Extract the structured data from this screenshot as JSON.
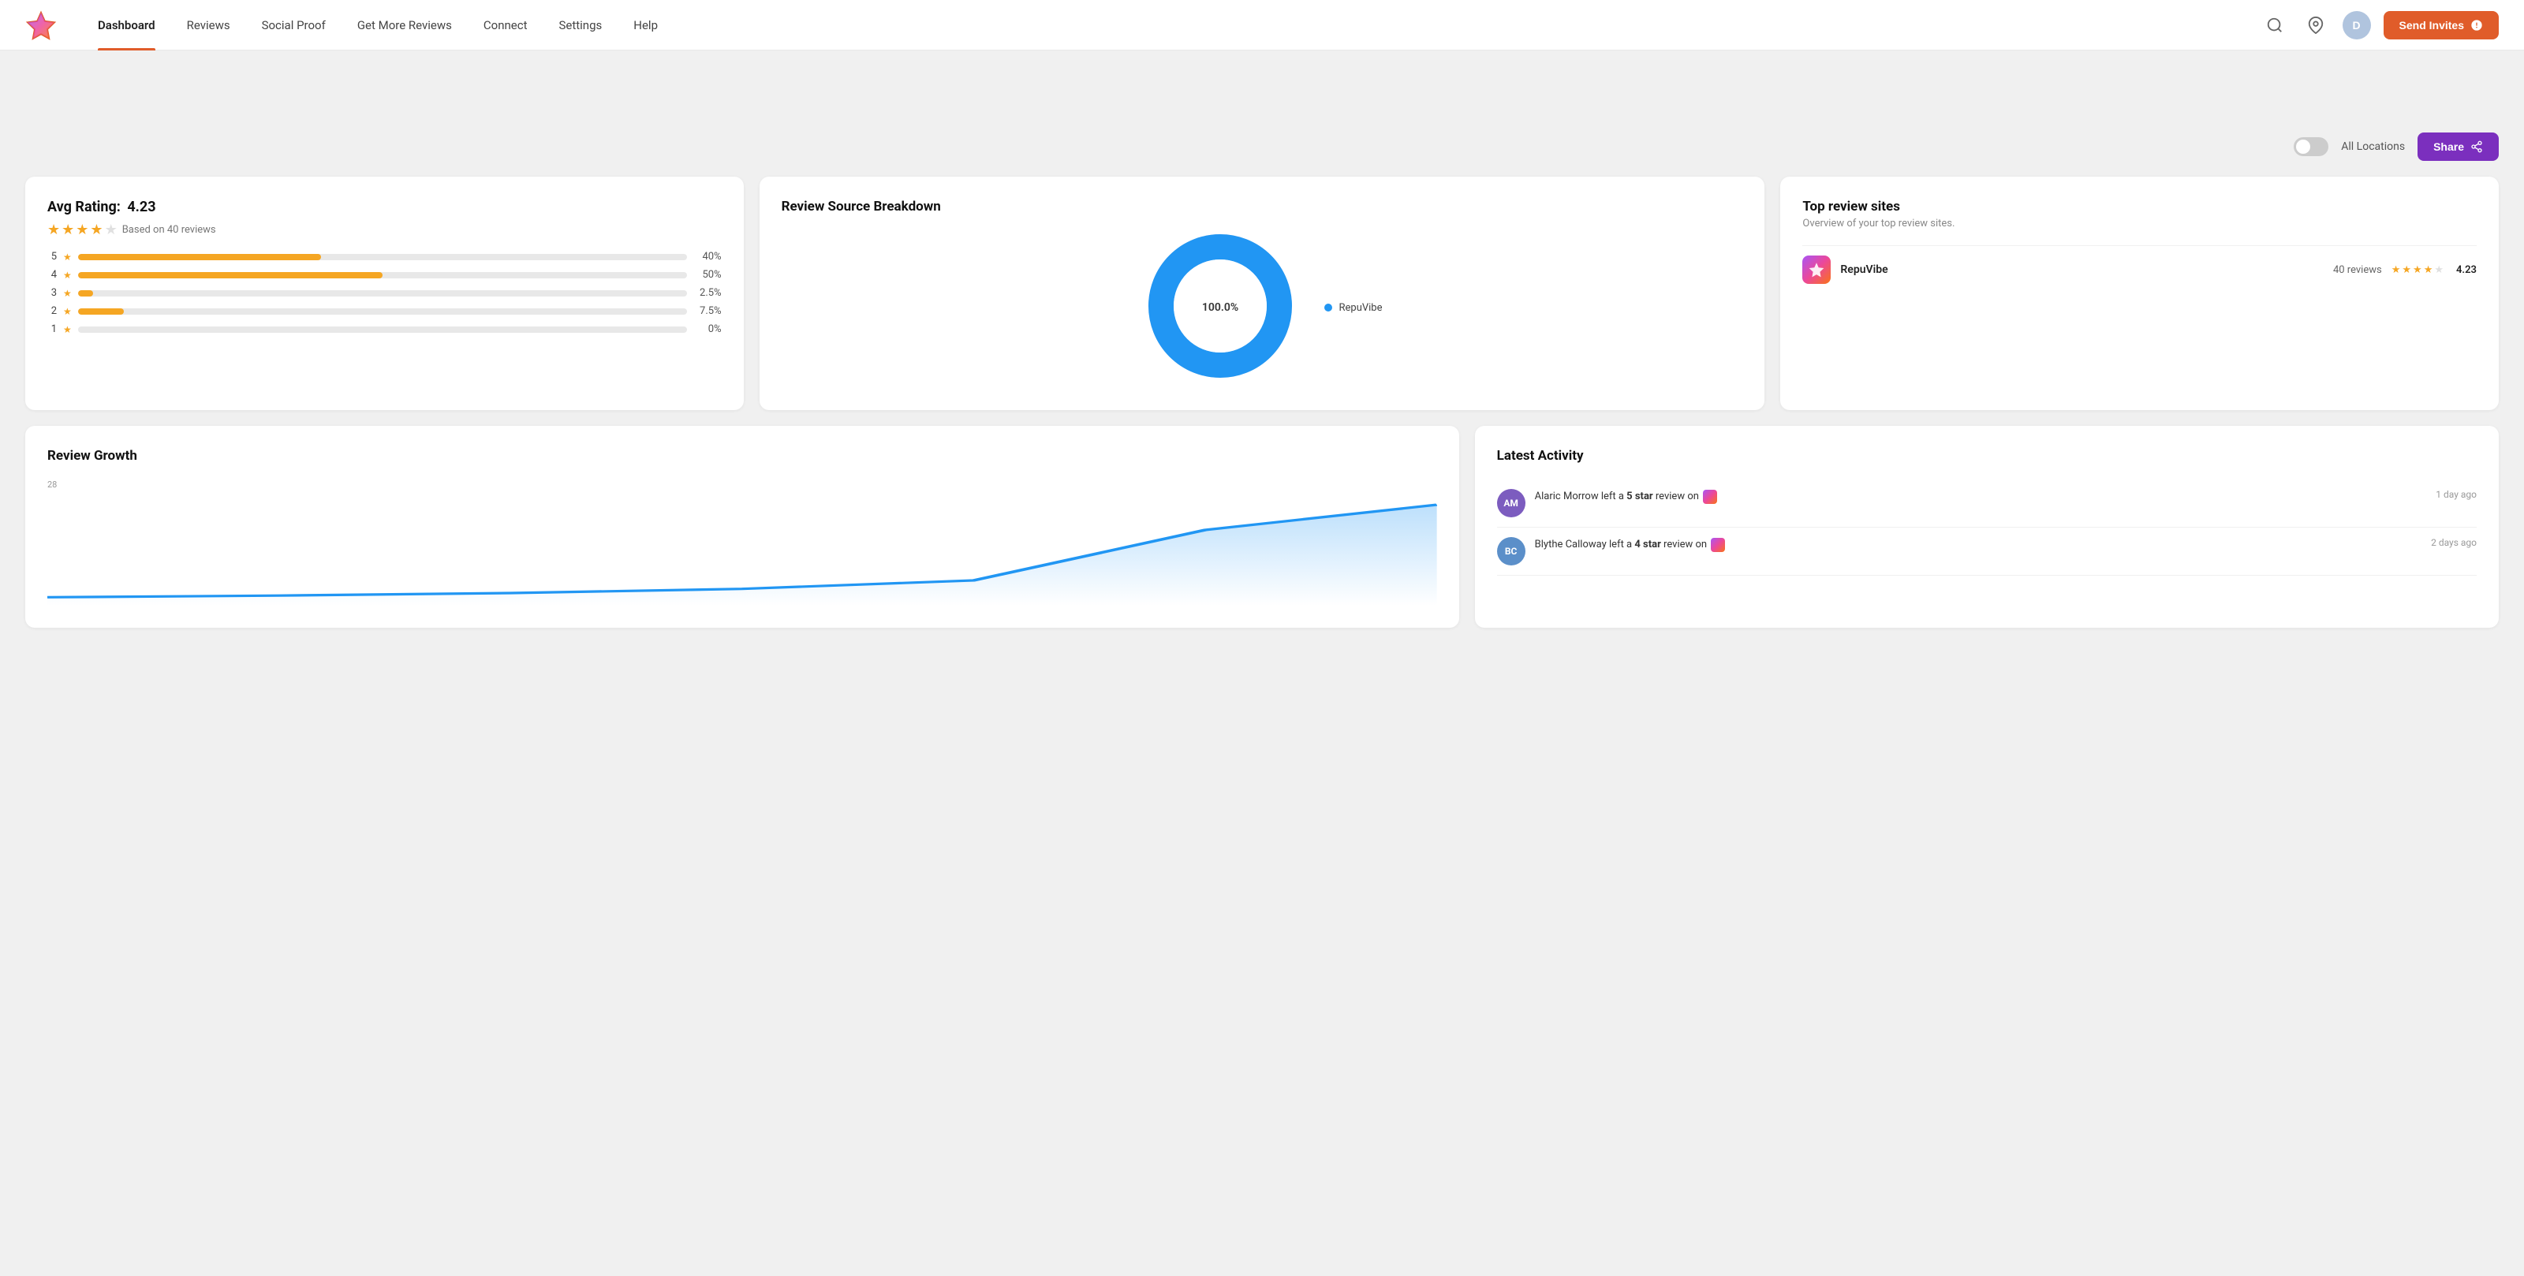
{
  "navbar": {
    "logo_alt": "RepuVibe Logo",
    "links": [
      {
        "label": "Dashboard",
        "active": true
      },
      {
        "label": "Reviews",
        "active": false
      },
      {
        "label": "Social Proof",
        "active": false
      },
      {
        "label": "Get More Reviews",
        "active": false
      },
      {
        "label": "Connect",
        "active": false
      },
      {
        "label": "Settings",
        "active": false
      },
      {
        "label": "Help",
        "active": false
      }
    ],
    "avatar_initials": "D",
    "send_invites_label": "Send Invites"
  },
  "toolbar": {
    "all_locations_label": "All Locations",
    "share_label": "Share"
  },
  "avg_rating": {
    "title": "Avg Rating:",
    "rating": "4.23",
    "based_on": "Based on 40 reviews",
    "bars": [
      {
        "label": "5",
        "pct_value": 40,
        "pct_label": "40%"
      },
      {
        "label": "4",
        "pct_value": 50,
        "pct_label": "50%"
      },
      {
        "label": "3",
        "pct_value": 2.5,
        "pct_label": "2.5%"
      },
      {
        "label": "2",
        "pct_value": 7.5,
        "pct_label": "7.5%"
      },
      {
        "label": "1",
        "pct_value": 0,
        "pct_label": "0%"
      }
    ]
  },
  "review_source": {
    "title": "Review Source Breakdown",
    "donut_label": "100.0%",
    "donut_color": "#2196f3",
    "legend": [
      {
        "label": "RepuVibe",
        "color": "#2196f3"
      }
    ]
  },
  "top_sites": {
    "title": "Top review sites",
    "subtitle": "Overview of your top review sites.",
    "sites": [
      {
        "name": "RepuVibe",
        "reviews": "40 reviews",
        "stars": 4,
        "half_star": true,
        "rating": "4.23",
        "icon": "⭐"
      }
    ]
  },
  "review_growth": {
    "title": "Review Growth",
    "y_label": "28",
    "chart_peak": 28
  },
  "latest_activity": {
    "title": "Latest Activity",
    "items": [
      {
        "initials": "AM",
        "avatar_color": "#7c5cbf",
        "text_before": "Alaric Morrow left a ",
        "star_count": "5 star",
        "text_after": " review on",
        "time": "1 day ago"
      },
      {
        "initials": "BC",
        "avatar_color": "#5b8fc9",
        "text_before": "Blythe Calloway left a ",
        "star_count": "4 star",
        "text_after": " review on",
        "time": "2 days ago"
      }
    ]
  }
}
